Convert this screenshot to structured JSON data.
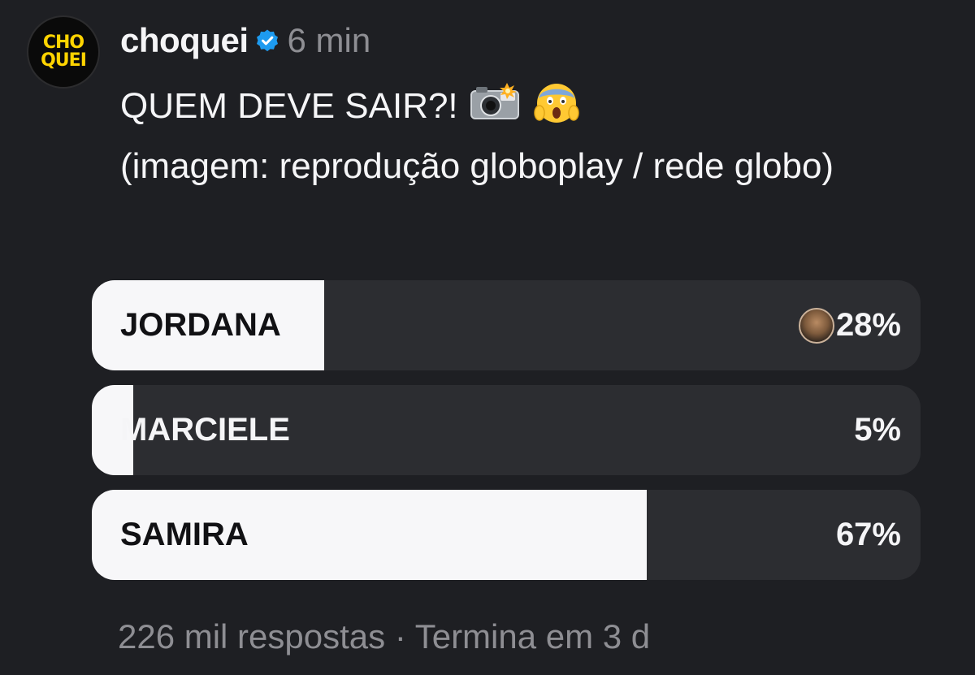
{
  "post": {
    "avatar_logo": [
      "CHO",
      "QUEI"
    ],
    "username": "choquei",
    "verified_icon": "verified-badge-icon",
    "time": "6 min",
    "title": "QUEM DEVE SAIR?!",
    "title_emojis": [
      "camera-flash-icon",
      "screaming-face-icon"
    ],
    "caption": "(imagem: reprodução globoplay / rede globo)"
  },
  "poll": {
    "options": [
      {
        "label": "JORDANA",
        "percent_text": "28%",
        "fill_fraction": 0.28,
        "selected_by_user": true
      },
      {
        "label": "MARCIELE",
        "percent_text": "5%",
        "fill_fraction": 0.05,
        "selected_by_user": false
      },
      {
        "label": "SAMIRA",
        "percent_text": "67%",
        "fill_fraction": 0.67,
        "selected_by_user": false
      }
    ],
    "footer": "226 mil respostas · Termina em 3 d"
  },
  "colors": {
    "background": "#1e1f23",
    "bar_track": "#2c2d31",
    "bar_fill": "#f7f7f9",
    "verified": "#1d9bf0",
    "logo": "#ffd400",
    "muted_text": "#8e8e93"
  }
}
